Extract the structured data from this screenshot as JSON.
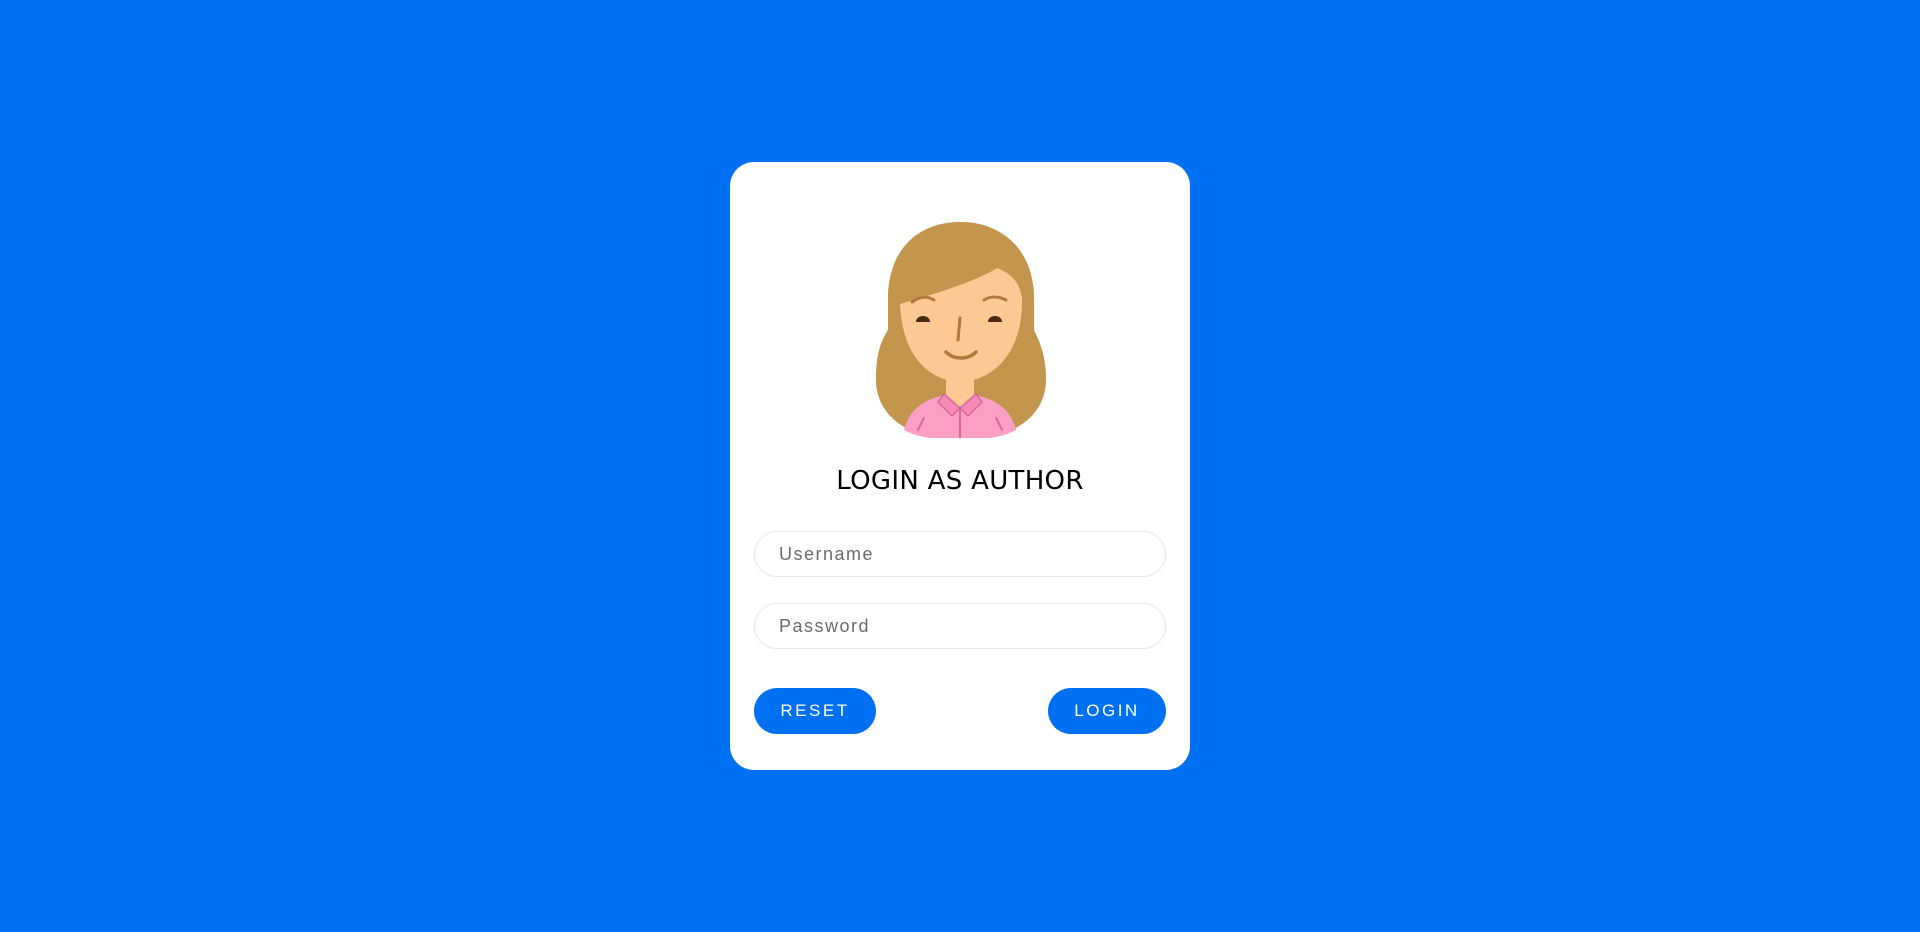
{
  "login_card": {
    "title": "LOGIN AS AUTHOR",
    "avatar_icon": "female-author-avatar-icon",
    "username": {
      "value": "",
      "placeholder": "Username"
    },
    "password": {
      "value": "",
      "placeholder": "Password"
    },
    "reset_label": "RESET",
    "login_label": "LOGIN"
  },
  "colors": {
    "background": "#0070f3",
    "card": "#ffffff",
    "button": "#0070f3",
    "button_text": "#ffffff",
    "title_text": "#000000"
  }
}
